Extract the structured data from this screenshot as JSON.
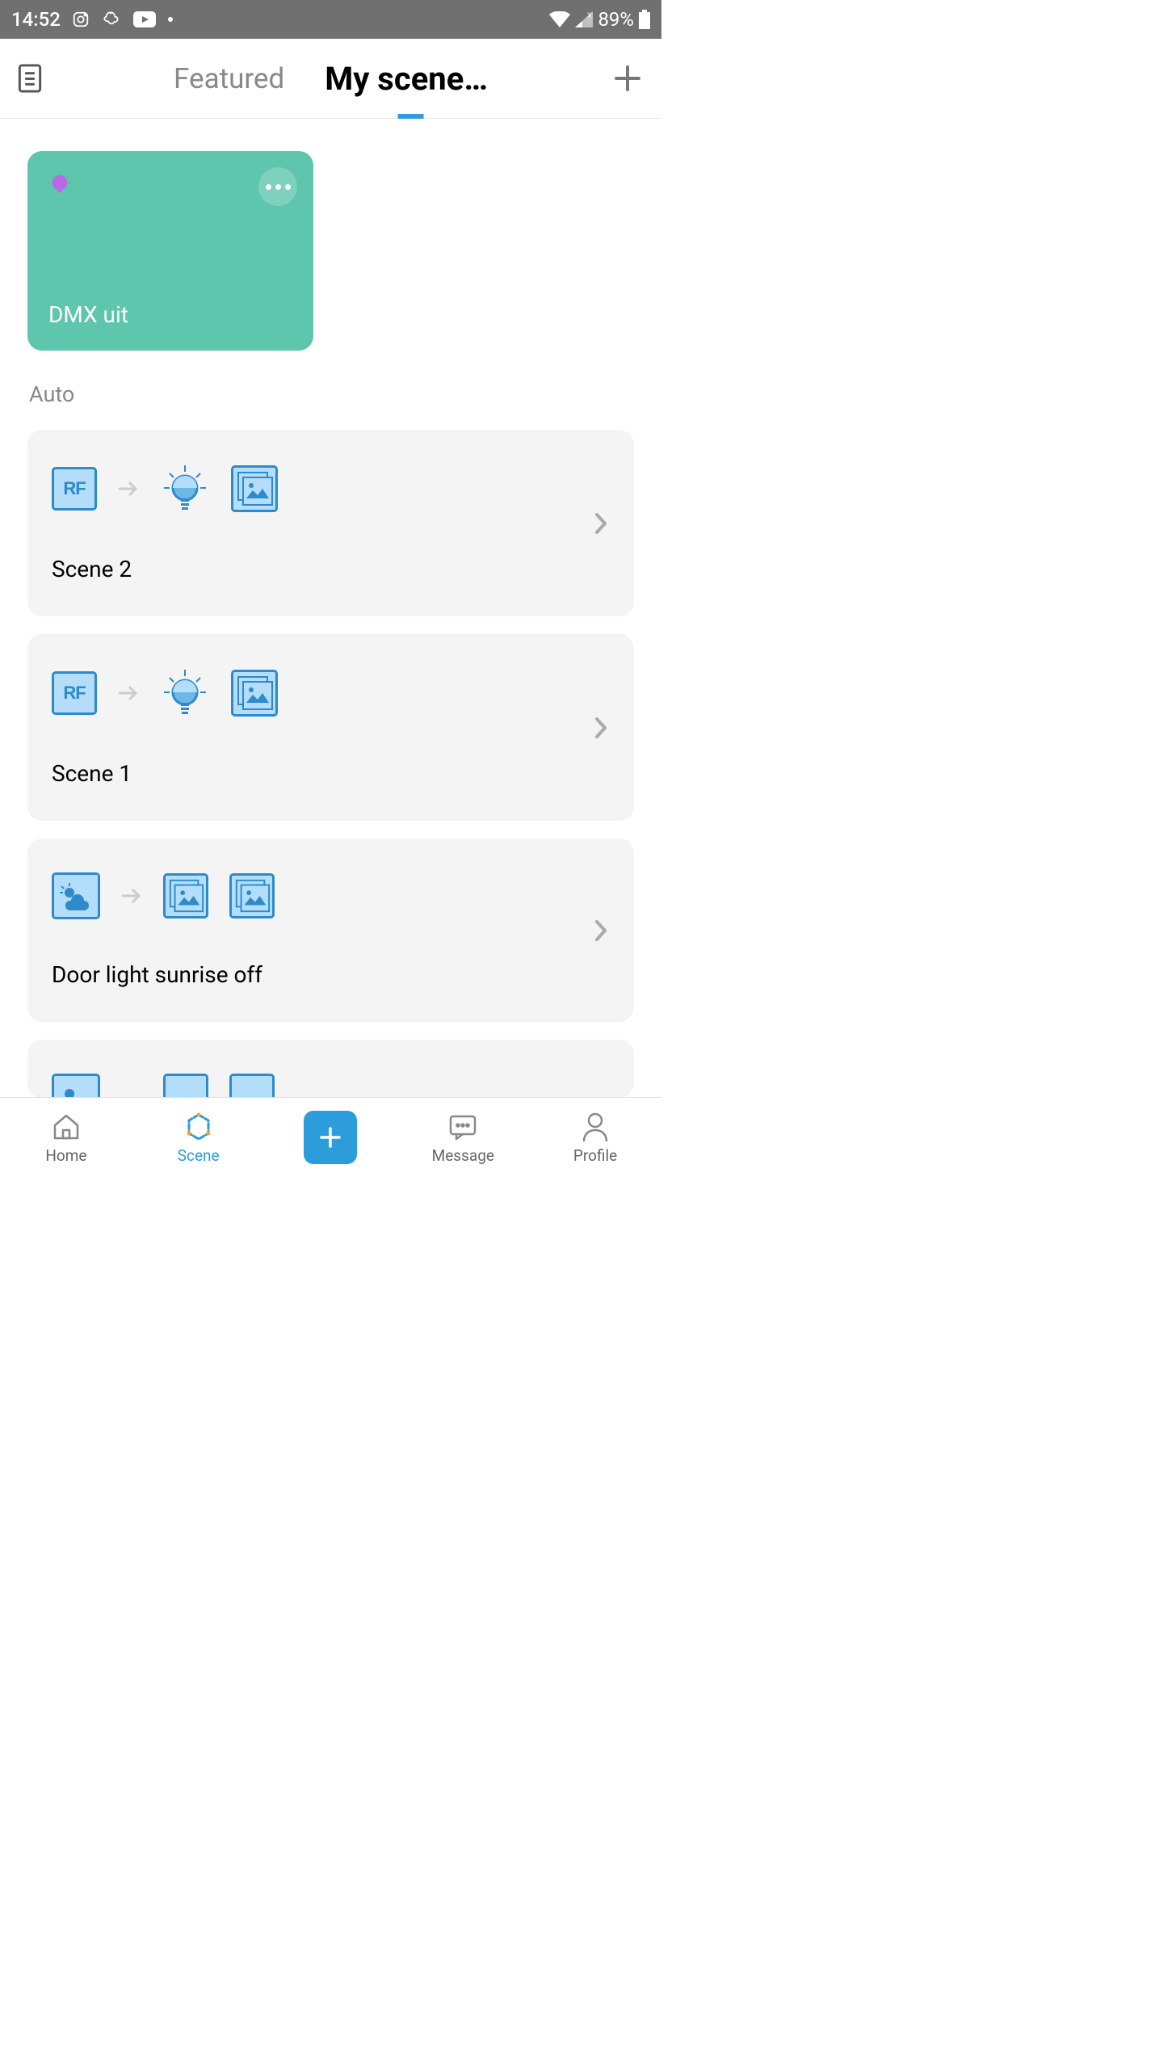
{
  "statusBar": {
    "time": "14:52",
    "battery": "89%"
  },
  "header": {
    "tabs": [
      "Featured",
      "My scene…"
    ],
    "activeIndex": 1
  },
  "featuredCard": {
    "title": "DMX uit"
  },
  "sectionHeading": "Auto",
  "autoScenes": [
    {
      "name": "Scene 2",
      "triggerType": "rf",
      "actions": [
        "bulb",
        "image"
      ]
    },
    {
      "name": "Scene 1",
      "triggerType": "rf",
      "actions": [
        "bulb",
        "image"
      ]
    },
    {
      "name": "Door light sunrise off",
      "triggerType": "weather",
      "actions": [
        "image",
        "image"
      ]
    },
    {
      "name": "",
      "triggerType": "weather",
      "actions": [
        "image",
        "image"
      ]
    }
  ],
  "bottomNav": {
    "items": [
      "Home",
      "Scene",
      "",
      "Message",
      "Profile"
    ],
    "activeIndex": 1
  }
}
